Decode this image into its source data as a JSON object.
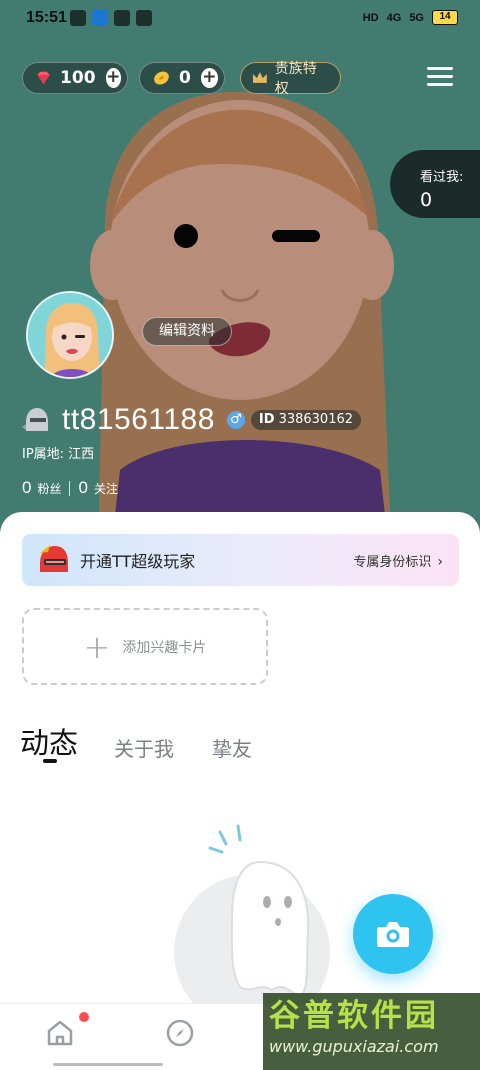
{
  "status_bar": {
    "time": "15:51",
    "battery": "14",
    "network_labels": [
      "HD",
      "4G",
      "5G"
    ]
  },
  "top_bar": {
    "gems_count": "100",
    "beans_count": "0",
    "noble_label": "贵族特权"
  },
  "visitors": {
    "label": "看过我:",
    "count": "0"
  },
  "profile": {
    "edit_label": "编辑资料",
    "username": "tt81561188",
    "gender_symbol": "♂",
    "id_prefix": "ID",
    "id_value": "338630162",
    "ip_label": "IP属地:",
    "ip_location": "江西",
    "fans_count": "0",
    "fans_label": "粉丝",
    "following_count": "0",
    "following_label": "关注"
  },
  "vip_banner": {
    "title": "开通TT超级玩家",
    "action": "专属身份标识",
    "chevron": "›"
  },
  "interest_card": {
    "plus": "+",
    "label": "添加兴趣卡片"
  },
  "tabs": [
    {
      "label": "动态",
      "active": true
    },
    {
      "label": "关于我",
      "active": false
    },
    {
      "label": "挚友",
      "active": false
    }
  ],
  "watermark": {
    "title": "谷普软件园",
    "url": "www.gupuxiazai.com"
  },
  "colors": {
    "hero_bg": "#427b70",
    "camera_button": "#2fc3ef",
    "badge_red": "#ff4d4f",
    "gender_blue": "#5ba7e8"
  },
  "icons": {
    "gems": "red-gem-icon",
    "beans": "gold-bean-icon",
    "noble": "crown-icon",
    "menu": "hamburger-menu-icon",
    "camera": "camera-icon",
    "home": "home-icon",
    "discover": "compass-icon"
  }
}
